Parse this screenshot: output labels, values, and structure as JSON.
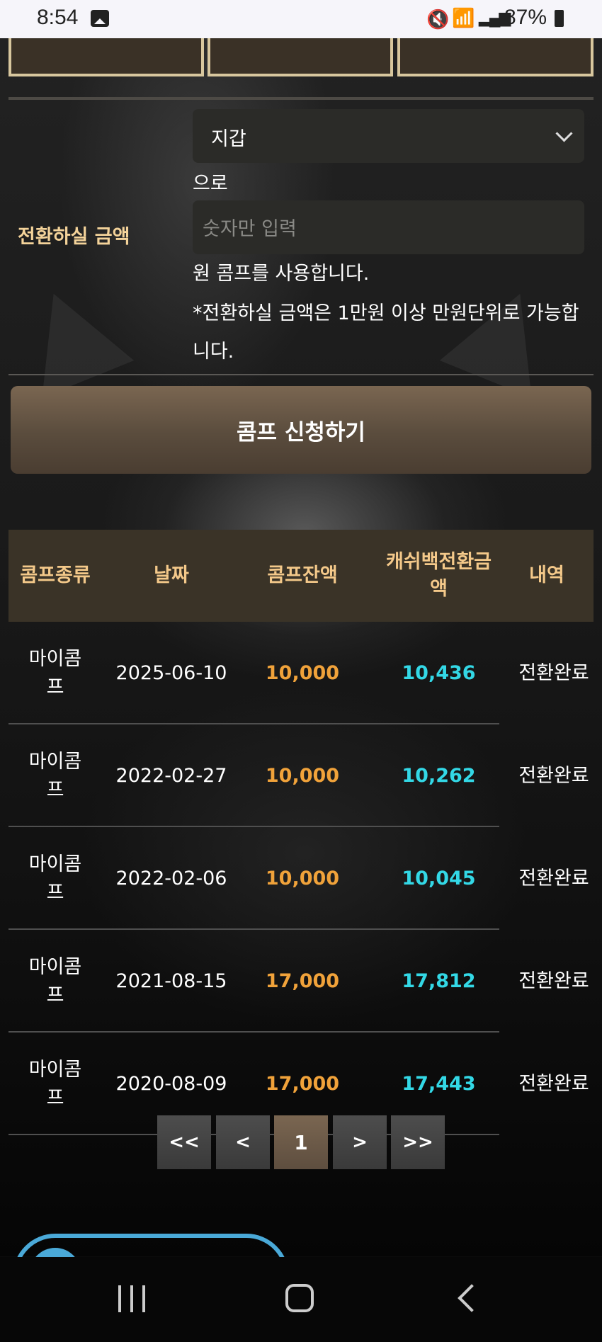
{
  "status_bar": {
    "time": "8:54",
    "battery": "87%"
  },
  "form": {
    "label": "전환하실 금액",
    "wallet_select_value": "지갑",
    "to_text": "으로",
    "amount_placeholder": "숫자만 입력",
    "note_use": "원 콤프를 사용합니다.",
    "note_rule": "*전환하실 금액은 1만원 이상 만원단위로 가능합니다."
  },
  "apply_button_label": "콤프 신청하기",
  "table": {
    "headers": [
      "콤프종류",
      "날짜",
      "콤프잔액",
      "캐쉬백전환금액",
      "내역"
    ],
    "rows": [
      {
        "type": "마이콤프",
        "date": "2025-06-10",
        "balance": "10,000",
        "cashback": "10,436",
        "status": "전환완료"
      },
      {
        "type": "마이콤프",
        "date": "2022-02-27",
        "balance": "10,000",
        "cashback": "10,262",
        "status": "전환완료"
      },
      {
        "type": "마이콤프",
        "date": "2022-02-06",
        "balance": "10,000",
        "cashback": "10,045",
        "status": "전환완료"
      },
      {
        "type": "마이콤프",
        "date": "2021-08-15",
        "balance": "17,000",
        "cashback": "17,812",
        "status": "전환완료"
      },
      {
        "type": "마이콤프",
        "date": "2020-08-09",
        "balance": "17,000",
        "cashback": "17,443",
        "status": "전환완료"
      }
    ]
  },
  "pagination": {
    "first": "<<",
    "prev": "<",
    "current": "1",
    "next": ">",
    "last": ">>"
  },
  "colors": {
    "label_gold": "#f4d39a",
    "balance_orange": "#f0a23a",
    "cashback_cyan": "#33d8e6",
    "button_brown": "#6b5948"
  }
}
